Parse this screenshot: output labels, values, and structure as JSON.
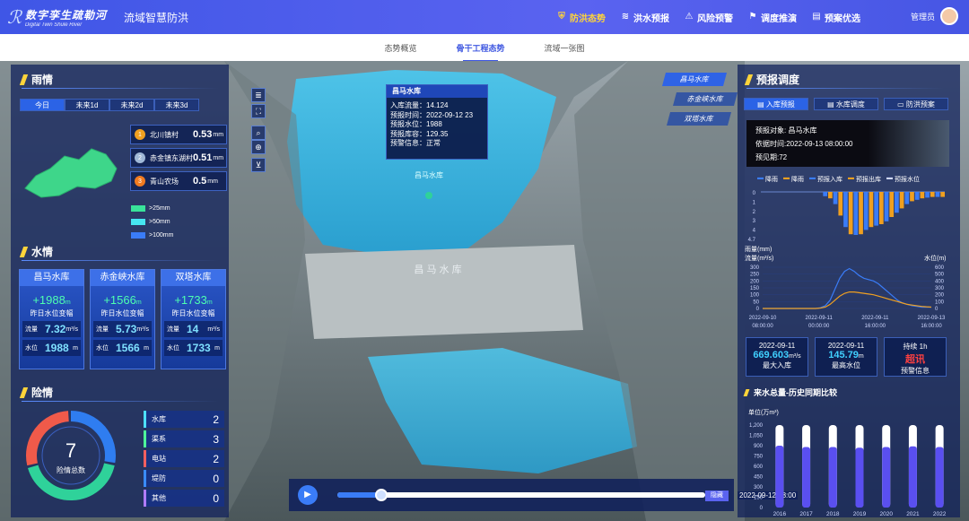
{
  "header": {
    "logo_title": "数字孪生疏勒河",
    "logo_subtitle": "Digital Twin Shule River",
    "app_name": "流域智慧防洪",
    "nav": [
      {
        "label": "防洪态势",
        "icon": "shield-icon",
        "active": true
      },
      {
        "label": "洪水预报",
        "icon": "wave-icon",
        "active": false
      },
      {
        "label": "风险预警",
        "icon": "alert-icon",
        "active": false
      },
      {
        "label": "调度推演",
        "icon": "flag-icon",
        "active": false
      },
      {
        "label": "预案优选",
        "icon": "doc-icon",
        "active": false
      }
    ],
    "user": "管理员"
  },
  "subnav": [
    {
      "label": "态势概览",
      "active": false
    },
    {
      "label": "骨干工程态势",
      "active": true
    },
    {
      "label": "流域一张图",
      "active": false
    }
  ],
  "rain": {
    "title": "雨情",
    "tabs": [
      "今日",
      "未来1d",
      "未来2d",
      "未来3d"
    ],
    "active_tab": 0,
    "stations": [
      {
        "rank": "1",
        "name": "北川镇村",
        "value": "0.53",
        "unit": "mm",
        "color": "#f0a020"
      },
      {
        "rank": "2",
        "name": "赤金镇东湖村",
        "value": "0.51",
        "unit": "mm",
        "color": "#a0b8d8"
      },
      {
        "rank": "3",
        "name": "青山农场",
        "value": "0.5",
        "unit": "mm",
        "color": "#f07a20"
      }
    ],
    "legend": [
      {
        "label": ">25mm",
        "color": "#39e39a"
      },
      {
        "label": ">50mm",
        "color": "#46e6f0"
      },
      {
        "label": ">100mm",
        "color": "#3a7cf7"
      }
    ]
  },
  "water": {
    "title": "水情",
    "cards": [
      {
        "name": "昌马水库",
        "change": "+1988",
        "change_unit": "m",
        "desc": "昨日水位变幅",
        "flow_label": "流量",
        "flow": "7.32",
        "flow_unit": "m³/s",
        "level_label": "水位",
        "level": "1988",
        "level_unit": "m"
      },
      {
        "name": "赤金峡水库",
        "change": "+1566",
        "change_unit": "m",
        "desc": "昨日水位变幅",
        "flow_label": "流量",
        "flow": "5.73",
        "flow_unit": "m³/s",
        "level_label": "水位",
        "level": "1566",
        "level_unit": "m"
      },
      {
        "name": "双塔水库",
        "change": "+1733",
        "change_unit": "m",
        "desc": "昨日水位变幅",
        "flow_label": "流量",
        "flow": "14",
        "flow_unit": "m³/s",
        "level_label": "水位",
        "level": "1733",
        "level_unit": "m"
      }
    ]
  },
  "danger": {
    "title": "险情",
    "total": "7",
    "total_label": "险情总数",
    "items": [
      {
        "name": "水库",
        "value": "2",
        "color": "#4de0ff"
      },
      {
        "name": "渠系",
        "value": "3",
        "color": "#4dff9a"
      },
      {
        "name": "电站",
        "value": "2",
        "color": "#ff5f5f"
      },
      {
        "name": "堤防",
        "value": "0",
        "color": "#3a8cff"
      },
      {
        "name": "其他",
        "value": "0",
        "color": "#b07cff"
      }
    ],
    "ring": [
      {
        "value": 2,
        "color": "#2f7df0"
      },
      {
        "value": 3,
        "color": "#2fd29a"
      },
      {
        "value": 2,
        "color": "#f05a4a"
      }
    ]
  },
  "popup": {
    "title": "昌马水库",
    "lines": [
      {
        "k": "入库流量：",
        "v": "14.124"
      },
      {
        "k": "预报时间：",
        "v": "2022-09-12 23"
      },
      {
        "k": "预报水位：",
        "v": "1988"
      },
      {
        "k": "预报库容：",
        "v": "129.35"
      },
      {
        "k": "预警信息：",
        "v": "正常"
      }
    ],
    "marker_label": "昌马水库"
  },
  "dam_text": "昌 马 水 库",
  "right_tabs": [
    "昌马水库",
    "赤金峡水库",
    "双塔水库"
  ],
  "forecast": {
    "title": "预报调度",
    "tabs": [
      "入库预报",
      "水库调度",
      "防洪预案"
    ],
    "active_tab": 0,
    "target": "预报对象: 昌马水库",
    "basis": "依据时间:2022-09-13 08:00:00",
    "period": "预见期:72",
    "legend": [
      {
        "label": "降雨",
        "color": "#3a7cf7"
      },
      {
        "label": "降雨",
        "color": "#f0a020"
      },
      {
        "label": "预报入库",
        "color": "#3a7cf7"
      },
      {
        "label": "预报出库",
        "color": "#f0a020"
      },
      {
        "label": "预报水位",
        "color": "#cfd8ff"
      }
    ],
    "rain_label": "雨量(mm)",
    "y_top": [
      "0",
      "1",
      "2",
      "3",
      "4",
      "4.7"
    ],
    "flow_label": "流量(m³/s)",
    "level_label": "水位(m)",
    "x_dates": [
      "2022-09-10",
      "2022-09-11",
      "2022-09-11",
      "2022-09-13"
    ],
    "x_times": [
      "08:00:00",
      "00:00:00",
      "16:00:00",
      "16:00:00"
    ]
  },
  "stats": [
    {
      "date": "2022-09-11",
      "value": "669.603",
      "unit": "m³/s",
      "label": "最大入库"
    },
    {
      "date": "2022-09-11",
      "value": "145.79",
      "unit": "m",
      "label": "最高水位"
    },
    {
      "date": "持续 1h",
      "value": "超讯",
      "unit": "",
      "label": "预警信息"
    }
  ],
  "history": {
    "title": "来水总量-历史同期比较",
    "unit": "单位(万m³)"
  },
  "timeline": {
    "date": "2022-09-12 08:00",
    "hide": "隐藏",
    "progress": 0.12
  },
  "chart_data": [
    {
      "type": "bar",
      "title": "来水总量-历史同期比较",
      "ylabel": "单位(万m³)",
      "categories": [
        "2016",
        "2017",
        "2018",
        "2019",
        "2020",
        "2021",
        "2022"
      ],
      "values": [
        900,
        880,
        880,
        870,
        880,
        890,
        880
      ],
      "ylim": [
        0,
        1200
      ],
      "yticks": [
        0,
        150,
        300,
        450,
        600,
        750,
        900,
        1050,
        1200
      ]
    },
    {
      "type": "line",
      "title": "预报调度",
      "series": [
        {
          "name": "预报入库",
          "values": [
            0,
            0,
            0,
            0,
            0,
            0,
            0,
            0,
            0,
            0,
            0,
            0,
            5,
            20,
            60,
            140,
            220,
            270,
            290,
            270,
            240,
            220,
            210,
            200,
            180,
            150,
            120,
            90,
            60,
            40,
            30,
            20,
            15,
            10,
            10,
            10
          ]
        },
        {
          "name": "预报出库",
          "values": [
            0,
            0,
            0,
            0,
            0,
            0,
            0,
            0,
            0,
            0,
            0,
            0,
            3,
            10,
            30,
            60,
            90,
            110,
            120,
            120,
            115,
            110,
            105,
            100,
            90,
            80,
            70,
            60,
            50,
            40,
            30,
            25,
            20,
            15,
            12,
            10
          ]
        }
      ],
      "ylim": [
        0,
        300
      ],
      "y_ticks": [
        "0",
        "50",
        "100",
        "150",
        "200",
        "250",
        "300"
      ],
      "y2_ticks": [
        "0",
        "100",
        "200",
        "300",
        "400",
        "500",
        "600"
      ]
    }
  ]
}
